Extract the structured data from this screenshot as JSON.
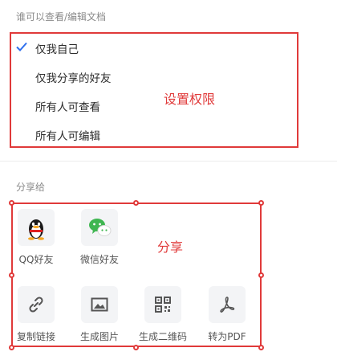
{
  "permissions": {
    "title": "谁可以查看/编辑文档",
    "options": [
      {
        "label": "仅我自己",
        "selected": true
      },
      {
        "label": "仅我分享的好友",
        "selected": false
      },
      {
        "label": "所有人可查看",
        "selected": false
      },
      {
        "label": "所有人可编辑",
        "selected": false
      }
    ],
    "annotation": "设置权限"
  },
  "share": {
    "title": "分享给",
    "annotation": "分享",
    "items": [
      {
        "label": "QQ好友",
        "icon": "qq-penguin-icon"
      },
      {
        "label": "微信好友",
        "icon": "wechat-icon"
      },
      {
        "label": "复制链接",
        "icon": "link-icon"
      },
      {
        "label": "生成图片",
        "icon": "image-icon"
      },
      {
        "label": "生成二维码",
        "icon": "qrcode-icon"
      },
      {
        "label": "转为PDF",
        "icon": "pdf-icon"
      }
    ]
  },
  "colors": {
    "annotation": "#e03a3a",
    "check": "#2f6fed",
    "wechat": "#3fb651"
  }
}
